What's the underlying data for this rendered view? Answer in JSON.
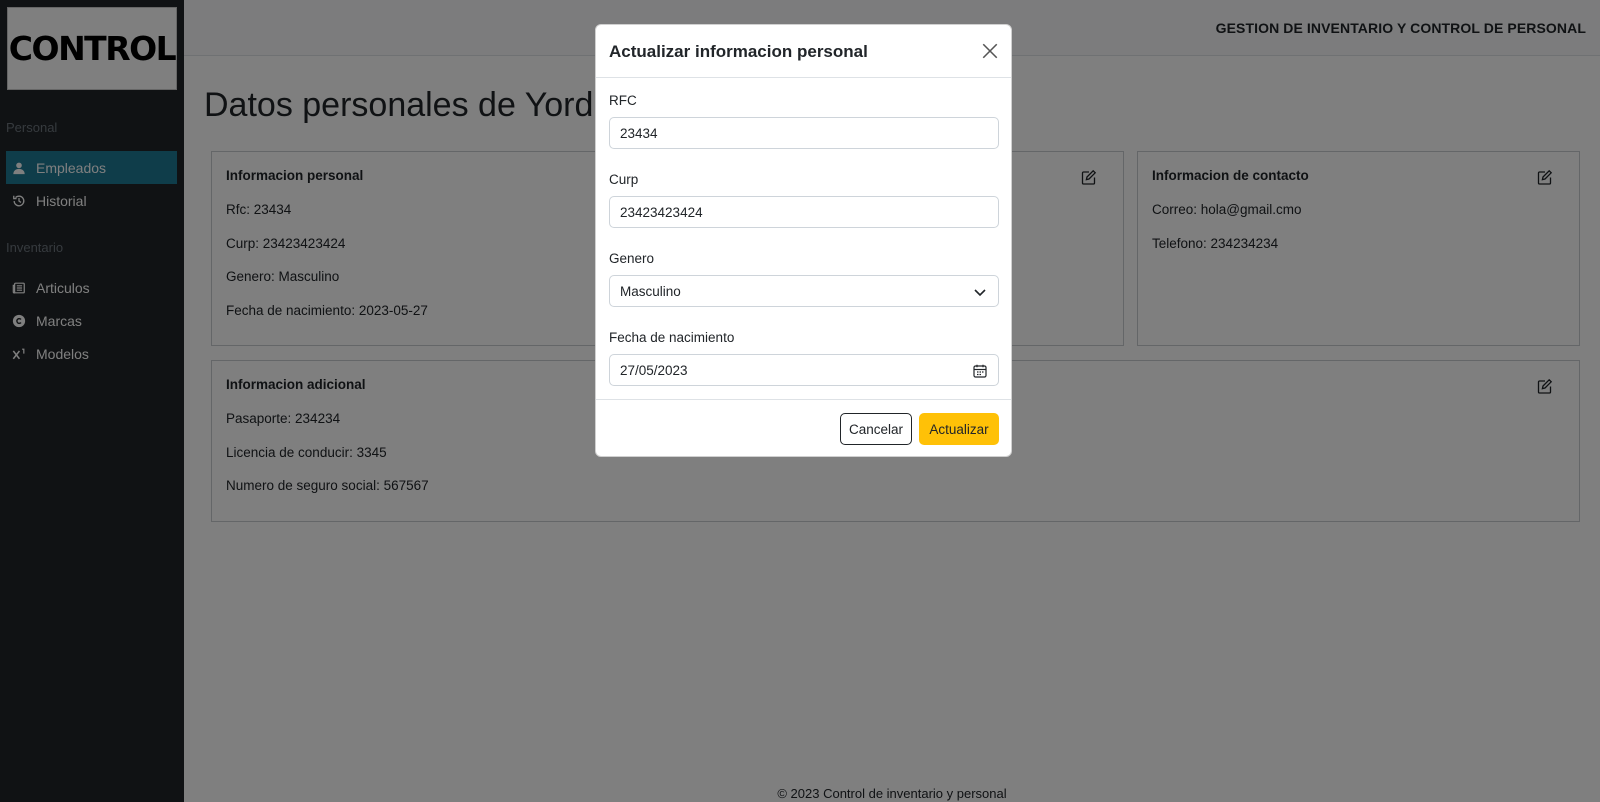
{
  "logo": {
    "text": "CONTROL"
  },
  "header": {
    "title": "GESTION DE INVENTARIO Y CONTROL DE PERSONAL"
  },
  "sidebar": {
    "section_personal": "Personal",
    "section_inventario": "Inventario",
    "items": [
      {
        "label": "Empleados",
        "icon": "person-icon",
        "active": true
      },
      {
        "label": "Historial",
        "icon": "history-icon",
        "active": false
      },
      {
        "label": "Articulos",
        "icon": "newspaper-icon",
        "active": false
      },
      {
        "label": "Marcas",
        "icon": "copyright-icon",
        "active": false
      },
      {
        "label": "Modelos",
        "icon": "superscript-icon",
        "active": false
      }
    ]
  },
  "page": {
    "title": "Datos personales de Yordii C"
  },
  "cards": {
    "personal": {
      "title": "Informacion personal",
      "lines": [
        "Rfc: 23434",
        "Curp: 23423423424",
        "Genero: Masculino",
        "Fecha de nacimiento: 2023-05-27"
      ]
    },
    "contact": {
      "title": "Informacion de contacto",
      "lines": [
        "Correo: hola@gmail.cmo",
        "Telefono: 234234234"
      ]
    },
    "additional": {
      "title": "Informacion adicional",
      "lines": [
        "Pasaporte: 234234",
        "Licencia de conducir: 3345",
        "Numero de seguro social: 567567"
      ]
    }
  },
  "footer": {
    "text": "© 2023 Control de inventario y personal"
  },
  "modal": {
    "title": "Actualizar informacion personal",
    "fields": {
      "rfc": {
        "label": "RFC",
        "value": "23434"
      },
      "curp": {
        "label": "Curp",
        "value": "23423423424"
      },
      "genero": {
        "label": "Genero",
        "value": "Masculino"
      },
      "fecha": {
        "label": "Fecha de nacimiento",
        "value": "27/05/2023"
      }
    },
    "cancel_label": "Cancelar",
    "update_label": "Actualizar"
  },
  "colors": {
    "sidebar_bg": "#212529",
    "active_item": "#1f7b95",
    "primary_button": "#ffc107"
  }
}
